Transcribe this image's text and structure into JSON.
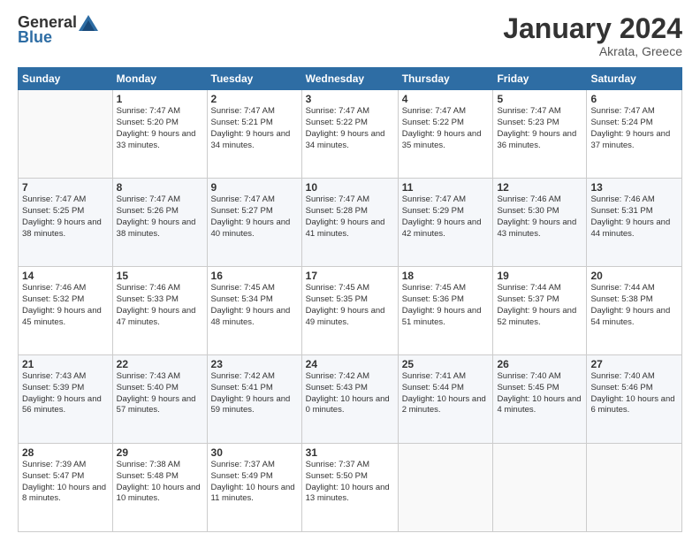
{
  "header": {
    "logo_general": "General",
    "logo_blue": "Blue",
    "month_title": "January 2024",
    "subtitle": "Akrata, Greece"
  },
  "weekdays": [
    "Sunday",
    "Monday",
    "Tuesday",
    "Wednesday",
    "Thursday",
    "Friday",
    "Saturday"
  ],
  "weeks": [
    [
      {
        "day": "",
        "sunrise": "",
        "sunset": "",
        "daylight": ""
      },
      {
        "day": "1",
        "sunrise": "Sunrise: 7:47 AM",
        "sunset": "Sunset: 5:20 PM",
        "daylight": "Daylight: 9 hours and 33 minutes."
      },
      {
        "day": "2",
        "sunrise": "Sunrise: 7:47 AM",
        "sunset": "Sunset: 5:21 PM",
        "daylight": "Daylight: 9 hours and 34 minutes."
      },
      {
        "day": "3",
        "sunrise": "Sunrise: 7:47 AM",
        "sunset": "Sunset: 5:22 PM",
        "daylight": "Daylight: 9 hours and 34 minutes."
      },
      {
        "day": "4",
        "sunrise": "Sunrise: 7:47 AM",
        "sunset": "Sunset: 5:22 PM",
        "daylight": "Daylight: 9 hours and 35 minutes."
      },
      {
        "day": "5",
        "sunrise": "Sunrise: 7:47 AM",
        "sunset": "Sunset: 5:23 PM",
        "daylight": "Daylight: 9 hours and 36 minutes."
      },
      {
        "day": "6",
        "sunrise": "Sunrise: 7:47 AM",
        "sunset": "Sunset: 5:24 PM",
        "daylight": "Daylight: 9 hours and 37 minutes."
      }
    ],
    [
      {
        "day": "7",
        "sunrise": "Sunrise: 7:47 AM",
        "sunset": "Sunset: 5:25 PM",
        "daylight": "Daylight: 9 hours and 38 minutes."
      },
      {
        "day": "8",
        "sunrise": "Sunrise: 7:47 AM",
        "sunset": "Sunset: 5:26 PM",
        "daylight": "Daylight: 9 hours and 38 minutes."
      },
      {
        "day": "9",
        "sunrise": "Sunrise: 7:47 AM",
        "sunset": "Sunset: 5:27 PM",
        "daylight": "Daylight: 9 hours and 40 minutes."
      },
      {
        "day": "10",
        "sunrise": "Sunrise: 7:47 AM",
        "sunset": "Sunset: 5:28 PM",
        "daylight": "Daylight: 9 hours and 41 minutes."
      },
      {
        "day": "11",
        "sunrise": "Sunrise: 7:47 AM",
        "sunset": "Sunset: 5:29 PM",
        "daylight": "Daylight: 9 hours and 42 minutes."
      },
      {
        "day": "12",
        "sunrise": "Sunrise: 7:46 AM",
        "sunset": "Sunset: 5:30 PM",
        "daylight": "Daylight: 9 hours and 43 minutes."
      },
      {
        "day": "13",
        "sunrise": "Sunrise: 7:46 AM",
        "sunset": "Sunset: 5:31 PM",
        "daylight": "Daylight: 9 hours and 44 minutes."
      }
    ],
    [
      {
        "day": "14",
        "sunrise": "Sunrise: 7:46 AM",
        "sunset": "Sunset: 5:32 PM",
        "daylight": "Daylight: 9 hours and 45 minutes."
      },
      {
        "day": "15",
        "sunrise": "Sunrise: 7:46 AM",
        "sunset": "Sunset: 5:33 PM",
        "daylight": "Daylight: 9 hours and 47 minutes."
      },
      {
        "day": "16",
        "sunrise": "Sunrise: 7:45 AM",
        "sunset": "Sunset: 5:34 PM",
        "daylight": "Daylight: 9 hours and 48 minutes."
      },
      {
        "day": "17",
        "sunrise": "Sunrise: 7:45 AM",
        "sunset": "Sunset: 5:35 PM",
        "daylight": "Daylight: 9 hours and 49 minutes."
      },
      {
        "day": "18",
        "sunrise": "Sunrise: 7:45 AM",
        "sunset": "Sunset: 5:36 PM",
        "daylight": "Daylight: 9 hours and 51 minutes."
      },
      {
        "day": "19",
        "sunrise": "Sunrise: 7:44 AM",
        "sunset": "Sunset: 5:37 PM",
        "daylight": "Daylight: 9 hours and 52 minutes."
      },
      {
        "day": "20",
        "sunrise": "Sunrise: 7:44 AM",
        "sunset": "Sunset: 5:38 PM",
        "daylight": "Daylight: 9 hours and 54 minutes."
      }
    ],
    [
      {
        "day": "21",
        "sunrise": "Sunrise: 7:43 AM",
        "sunset": "Sunset: 5:39 PM",
        "daylight": "Daylight: 9 hours and 56 minutes."
      },
      {
        "day": "22",
        "sunrise": "Sunrise: 7:43 AM",
        "sunset": "Sunset: 5:40 PM",
        "daylight": "Daylight: 9 hours and 57 minutes."
      },
      {
        "day": "23",
        "sunrise": "Sunrise: 7:42 AM",
        "sunset": "Sunset: 5:41 PM",
        "daylight": "Daylight: 9 hours and 59 minutes."
      },
      {
        "day": "24",
        "sunrise": "Sunrise: 7:42 AM",
        "sunset": "Sunset: 5:43 PM",
        "daylight": "Daylight: 10 hours and 0 minutes."
      },
      {
        "day": "25",
        "sunrise": "Sunrise: 7:41 AM",
        "sunset": "Sunset: 5:44 PM",
        "daylight": "Daylight: 10 hours and 2 minutes."
      },
      {
        "day": "26",
        "sunrise": "Sunrise: 7:40 AM",
        "sunset": "Sunset: 5:45 PM",
        "daylight": "Daylight: 10 hours and 4 minutes."
      },
      {
        "day": "27",
        "sunrise": "Sunrise: 7:40 AM",
        "sunset": "Sunset: 5:46 PM",
        "daylight": "Daylight: 10 hours and 6 minutes."
      }
    ],
    [
      {
        "day": "28",
        "sunrise": "Sunrise: 7:39 AM",
        "sunset": "Sunset: 5:47 PM",
        "daylight": "Daylight: 10 hours and 8 minutes."
      },
      {
        "day": "29",
        "sunrise": "Sunrise: 7:38 AM",
        "sunset": "Sunset: 5:48 PM",
        "daylight": "Daylight: 10 hours and 10 minutes."
      },
      {
        "day": "30",
        "sunrise": "Sunrise: 7:37 AM",
        "sunset": "Sunset: 5:49 PM",
        "daylight": "Daylight: 10 hours and 11 minutes."
      },
      {
        "day": "31",
        "sunrise": "Sunrise: 7:37 AM",
        "sunset": "Sunset: 5:50 PM",
        "daylight": "Daylight: 10 hours and 13 minutes."
      },
      {
        "day": "",
        "sunrise": "",
        "sunset": "",
        "daylight": ""
      },
      {
        "day": "",
        "sunrise": "",
        "sunset": "",
        "daylight": ""
      },
      {
        "day": "",
        "sunrise": "",
        "sunset": "",
        "daylight": ""
      }
    ]
  ]
}
